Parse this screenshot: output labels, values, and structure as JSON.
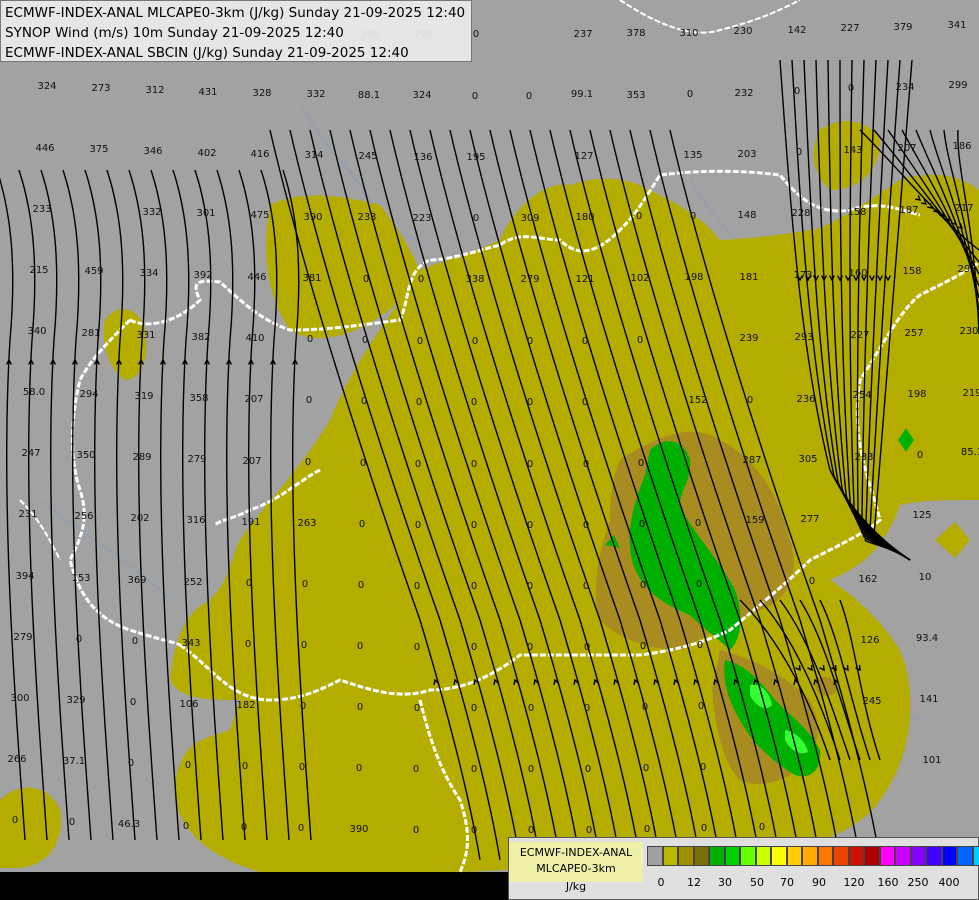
{
  "title_lines": [
    "ECMWF-INDEX-ANAL MLCAPE0-3km (J/kg) Sunday 21-09-2025 12:40",
    "SYNOP Wind (m/s) 10m Sunday 21-09-2025 12:40",
    "ECMWF-INDEX-ANAL SBCIN (J/kg) Sunday 21-09-2025 12:40"
  ],
  "legend": {
    "name_line1": "ECMWF-INDEX-ANAL",
    "name_line2": "MLCAPE0-3km",
    "unit": "J/kg",
    "colors": [
      "#a0a0a0",
      "#b8b800",
      "#a09000",
      "#7a7000",
      "#00b000",
      "#00d000",
      "#66ff00",
      "#ccff00",
      "#ffff00",
      "#ffcc00",
      "#ffaa00",
      "#ff7700",
      "#ee4400",
      "#cc1100",
      "#aa0000",
      "#ff00ff",
      "#cc00ff",
      "#8800ff",
      "#4400ff",
      "#0000ff",
      "#0066ff",
      "#00ccff",
      "#66ffff",
      "#ffffff"
    ],
    "ticks": [
      "0",
      "12",
      "30",
      "50",
      "70",
      "90",
      "120",
      "160",
      "250",
      "400"
    ]
  },
  "map_colors": {
    "background": "#a2a2a2",
    "cape_low": "#b4ad00",
    "cape_mid": "#a88c20",
    "cape_green": "#00b000",
    "cape_bright": "#33ff33",
    "border": "#ffffff",
    "river": "#7f9bbf",
    "streamline": "#000000",
    "no_data": "#000000"
  },
  "cin_values": [
    {
      "t": "324"
    },
    {
      "t": "273"
    },
    {
      "t": "312"
    },
    {
      "t": "431"
    },
    {
      "t": "328"
    },
    {
      "t": "332"
    },
    {
      "t": "88.1"
    },
    {
      "t": "324"
    },
    {
      "t": "0"
    },
    {
      "t": "0"
    },
    {
      "t": "99.1"
    },
    {
      "t": "353"
    },
    {
      "t": "0"
    },
    {
      "t": "232"
    },
    {
      "t": "0"
    },
    {
      "t": "0"
    },
    {
      "t": "234"
    },
    {
      "t": "299"
    },
    {
      "t": "237"
    },
    {
      "t": "378"
    },
    {
      "t": "310"
    },
    {
      "t": "230"
    },
    {
      "t": "142"
    },
    {
      "t": "227"
    },
    {
      "t": "379"
    },
    {
      "t": "341"
    },
    {
      "t": "446"
    },
    {
      "t": "375"
    },
    {
      "t": "346"
    },
    {
      "t": "402"
    },
    {
      "t": "416"
    },
    {
      "t": "314"
    },
    {
      "t": "245"
    },
    {
      "t": "136"
    },
    {
      "t": "195"
    },
    {
      "t": "127"
    },
    {
      "t": "135"
    },
    {
      "t": "203"
    },
    {
      "t": "0"
    },
    {
      "t": "143"
    },
    {
      "t": "207"
    },
    {
      "t": "186"
    },
    {
      "t": "233"
    },
    {
      "t": "332"
    },
    {
      "t": "301"
    },
    {
      "t": "475"
    },
    {
      "t": "390"
    },
    {
      "t": "233"
    },
    {
      "t": "223"
    },
    {
      "t": "0"
    },
    {
      "t": "309"
    },
    {
      "t": "180"
    },
    {
      "t": "0"
    },
    {
      "t": "0"
    },
    {
      "t": "148"
    },
    {
      "t": "228"
    },
    {
      "t": "158"
    },
    {
      "t": "187"
    },
    {
      "t": "217"
    },
    {
      "t": "215"
    },
    {
      "t": "459"
    },
    {
      "t": "334"
    },
    {
      "t": "392"
    },
    {
      "t": "446"
    },
    {
      "t": "381"
    },
    {
      "t": "0"
    },
    {
      "t": "0"
    },
    {
      "t": "338"
    },
    {
      "t": "279"
    },
    {
      "t": "121"
    },
    {
      "t": "102"
    },
    {
      "t": "198"
    },
    {
      "t": "181"
    },
    {
      "t": "173"
    },
    {
      "t": "160"
    },
    {
      "t": "158"
    },
    {
      "t": "293"
    },
    {
      "t": "340"
    },
    {
      "t": "281"
    },
    {
      "t": "331"
    },
    {
      "t": "382"
    },
    {
      "t": "410"
    },
    {
      "t": "0"
    },
    {
      "t": "0"
    },
    {
      "t": "0"
    },
    {
      "t": "0"
    },
    {
      "t": "0"
    },
    {
      "t": "0"
    },
    {
      "t": "0"
    },
    {
      "t": "239"
    },
    {
      "t": "293"
    },
    {
      "t": "227"
    },
    {
      "t": "257"
    },
    {
      "t": "230"
    },
    {
      "t": "58.0"
    },
    {
      "t": "294"
    },
    {
      "t": "319"
    },
    {
      "t": "358"
    },
    {
      "t": "207"
    },
    {
      "t": "0"
    },
    {
      "t": "0"
    },
    {
      "t": "0"
    },
    {
      "t": "0"
    },
    {
      "t": "0"
    },
    {
      "t": "0"
    },
    {
      "t": "152"
    },
    {
      "t": "0"
    },
    {
      "t": "236"
    },
    {
      "t": "254"
    },
    {
      "t": "198"
    },
    {
      "t": "219"
    },
    {
      "t": "247"
    },
    {
      "t": "350"
    },
    {
      "t": "289"
    },
    {
      "t": "279"
    },
    {
      "t": "207"
    },
    {
      "t": "0"
    },
    {
      "t": "0"
    },
    {
      "t": "0"
    },
    {
      "t": "0"
    },
    {
      "t": "0"
    },
    {
      "t": "0"
    },
    {
      "t": "0"
    },
    {
      "t": "287"
    },
    {
      "t": "305"
    },
    {
      "t": "233"
    },
    {
      "t": "0"
    },
    {
      "t": "85.1"
    },
    {
      "t": "231"
    },
    {
      "t": "256"
    },
    {
      "t": "202"
    },
    {
      "t": "316"
    },
    {
      "t": "191"
    },
    {
      "t": "263"
    },
    {
      "t": "0"
    },
    {
      "t": "0"
    },
    {
      "t": "0"
    },
    {
      "t": "0"
    },
    {
      "t": "0"
    },
    {
      "t": "0"
    },
    {
      "t": "0"
    },
    {
      "t": "159"
    },
    {
      "t": "277"
    },
    {
      "t": "125"
    },
    {
      "t": "394"
    },
    {
      "t": "153"
    },
    {
      "t": "369"
    },
    {
      "t": "252"
    },
    {
      "t": "0"
    },
    {
      "t": "0"
    },
    {
      "t": "0"
    },
    {
      "t": "0"
    },
    {
      "t": "0"
    },
    {
      "t": "0"
    },
    {
      "t": "0"
    },
    {
      "t": "0"
    },
    {
      "t": "0"
    },
    {
      "t": "0"
    },
    {
      "t": "162"
    },
    {
      "t": "10"
    },
    {
      "t": "279"
    },
    {
      "t": "0"
    },
    {
      "t": "0"
    },
    {
      "t": "343"
    },
    {
      "t": "0"
    },
    {
      "t": "0"
    },
    {
      "t": "0"
    },
    {
      "t": "0"
    },
    {
      "t": "0"
    },
    {
      "t": "0"
    },
    {
      "t": "0"
    },
    {
      "t": "0"
    },
    {
      "t": "0"
    },
    {
      "t": "126"
    },
    {
      "t": "93.4"
    },
    {
      "t": "300"
    },
    {
      "t": "329"
    },
    {
      "t": "0"
    },
    {
      "t": "106"
    },
    {
      "t": "182"
    },
    {
      "t": "0"
    },
    {
      "t": "0"
    },
    {
      "t": "0"
    },
    {
      "t": "0"
    },
    {
      "t": "0"
    },
    {
      "t": "0"
    },
    {
      "t": "0"
    },
    {
      "t": "0"
    },
    {
      "t": "245"
    },
    {
      "t": "141"
    },
    {
      "t": "266"
    },
    {
      "t": "37.1"
    },
    {
      "t": "0"
    },
    {
      "t": "0"
    },
    {
      "t": "0"
    },
    {
      "t": "0"
    },
    {
      "t": "0"
    },
    {
      "t": "0"
    },
    {
      "t": "0"
    },
    {
      "t": "0"
    },
    {
      "t": "0"
    },
    {
      "t": "0"
    },
    {
      "t": "0"
    },
    {
      "t": "101"
    },
    {
      "t": "0"
    },
    {
      "t": "0"
    },
    {
      "t": "46.3"
    },
    {
      "t": "0"
    },
    {
      "t": "0"
    },
    {
      "t": "0"
    },
    {
      "t": "390"
    },
    {
      "t": "0"
    },
    {
      "t": "0"
    },
    {
      "t": "0"
    },
    {
      "t": "0"
    },
    {
      "t": "0"
    },
    {
      "t": "0"
    },
    {
      "t": "0"
    },
    {
      "t": "209"
    },
    {
      "t": "298"
    },
    {
      "t": "0"
    }
  ]
}
